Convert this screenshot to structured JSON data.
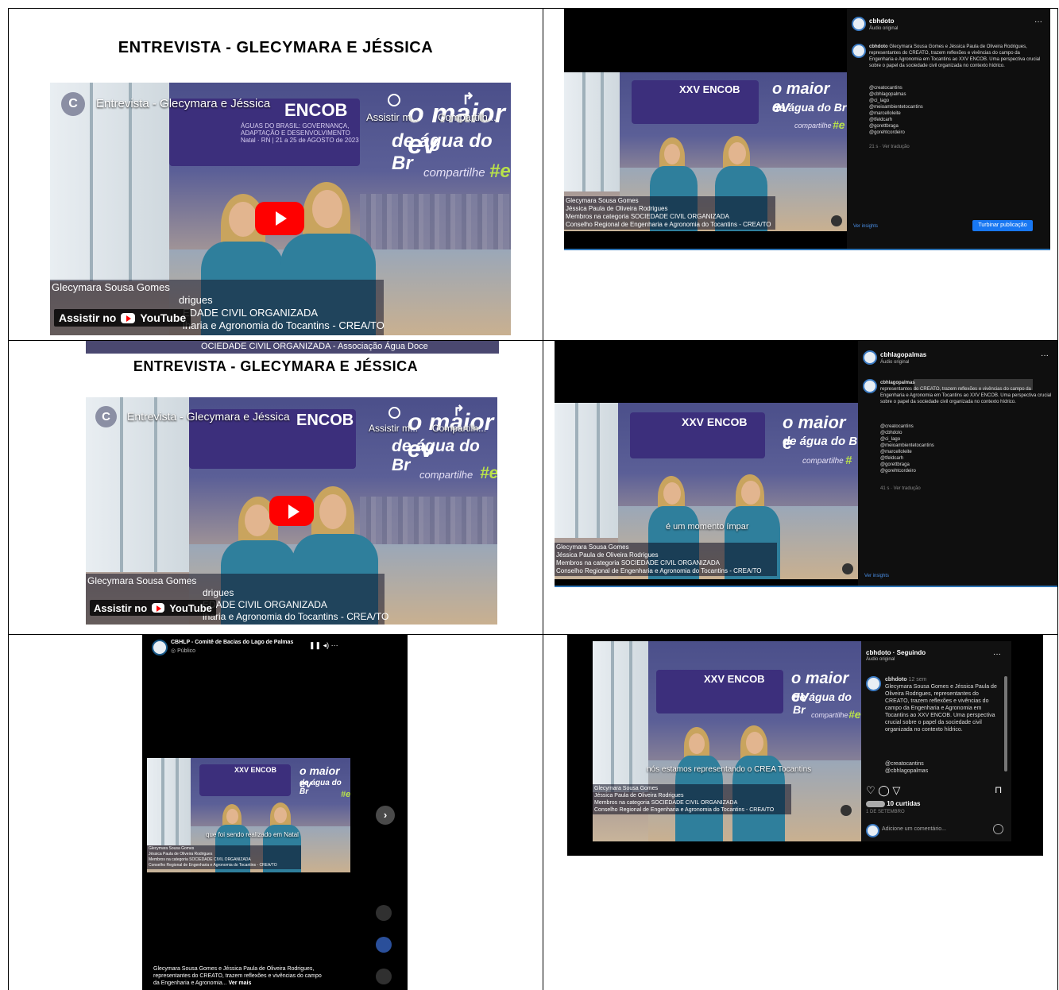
{
  "cell1": {
    "heading": "ENTREVISTA - GLECYMARA E JÉSSICA",
    "video_title": "Entrevista - Glecymara e Jéssica",
    "channel_initial": "C",
    "watch_later": "Assistir m...",
    "share": "Compartilh...",
    "encob": "ENCOB",
    "encob_sub1": "ÁGUAS DO BRASIL: GOVERNANÇA,",
    "encob_sub2": "ADAPTAÇÃO E DESENVOLVIMENTO",
    "encob_date": "Natal · RN  |  21 a 25 de AGOSTO de 2023",
    "slogan1": "o maior ev",
    "slogan2": "de água do Br",
    "compartilhe": "compartilhe",
    "hash": "#e",
    "lt1": "Glecymara Sousa Gomes",
    "lt2": "drigues",
    "lt3": "EDADE CIVIL ORGANIZADA",
    "lt4": "lharia e Agronomia do Tocantins - CREA/TO",
    "watch_on": "Assistir no",
    "youtube": "YouTube",
    "below_strip": "OCIEDADE CIVIL ORGANIZADA - Associação Água Doce"
  },
  "cell2": {
    "heading": "ENTREVISTA - GLECYMARA E JÉSSICA",
    "video_title": "Entrevista - Glecymara e Jéssica",
    "channel_initial": "C",
    "watch_later": "Assistir m...",
    "share": "Compartilh...",
    "encob": "ENCOB",
    "slogan1": "o maior ev",
    "slogan2": "de água do Br",
    "compartilhe": "compartilhe",
    "hash": "#e",
    "lt1": "Glecymara Sousa Gomes",
    "lt2": "drigues",
    "lt3": "EDADE CIVIL ORGANIZADA",
    "lt4": "lharia e Agronomia do Tocantins - CREA/TO",
    "watch_on": "Assistir no",
    "youtube": "YouTube"
  },
  "ig1": {
    "user": "cbhdoto",
    "audio": "Áudio original",
    "caption_user": "cbhdoto",
    "caption": "Glecymara Sousa Gomes e Jéssica Paula de Oliveira Rodrigues, representantes do CREATO, trazem reflexões e vivências do campo da Engenharia e Agronomia em Tocantins ao XXV ENCOB. Uma perspectiva crucial sobre o papel da sociedade civil organizada no contexto hídrico.",
    "tags": [
      "@creatocantins",
      "@cbhlagopalmas",
      "@ci_lago",
      "@meioambientetocantins",
      "@marcelloleite",
      "@tfeldcarh",
      "@gorettbraga",
      "@gorehtcordeiro"
    ],
    "time": "21 s · Ver tradução",
    "insights": "Ver insights",
    "boost": "Turbinar publicação",
    "xxv": "XXV ENCOB",
    "slogan1": "o maior ev",
    "slogan2": "de água do Br",
    "compartilhe": "compartilhe",
    "hash": "#e",
    "lt": [
      "Glecymara Sousa Gomes",
      "Jéssica Paula de Oliveira Rodrigues",
      "Membros na categoria SOCIEDADE CIVIL ORGANIZADA",
      "Conselho Regional de Engenharia e Agronomia do Tocantins - CREA/TO"
    ]
  },
  "ig2": {
    "user": "cbhlagopalmas",
    "audio": "Áudio original",
    "caption_user": "cbhlagopalmas",
    "caption": "representantes do CREATO, trazem reflexões e vivências do campo da Engenharia e Agronomia em Tocantins ao XXV ENCOB. Uma perspectiva crucial sobre o papel da sociedade civil organizada no contexto hídrico.",
    "tags": [
      "@creatocantins",
      "@cbhdoto",
      "@ci_lago",
      "@meioambientetocantins",
      "@marcelloleite",
      "@tfeldcarh",
      "@gorettbraga",
      "@gorehtcordeiro"
    ],
    "time": "41 s · Ver tradução",
    "insights": "Ver insights",
    "xxv": "XXV ENCOB",
    "slogan1": "o maior e",
    "slogan2": "de água do B",
    "compartilhe": "compartilhe",
    "hash": "#",
    "subtitle": "é um momento ímpar",
    "lt": [
      "Glecymara Sousa Gomes",
      "Jéssica Paula de Oliveira Rodrigues",
      "Membros na categoria SOCIEDADE CIVIL ORGANIZADA",
      "Conselho Regional de Engenharia e Agronomia do Tocantins - CREA/TO"
    ]
  },
  "fb": {
    "page": "CBHLP - Comitê de Bacias do Lago de Palmas",
    "visibility": "Público",
    "xxv": "XXV ENCOB",
    "slogan1": "o maior ev",
    "slogan2": "de água do Br",
    "hash": "#e",
    "subtitle": "que foi sendo realizado em Natal",
    "lt": [
      "Glecymara Sousa Gomes",
      "Jéssica Paula de Oliveira Rodrigues",
      "Membros na categoria SOCIEDADE CIVIL ORGANIZADA",
      "Conselho Regional de Engenharia e Agronomia do Tocantins - CREA/TO"
    ],
    "caption1": "Glecymara Sousa Gomes e Jéssica Paula de Oliveira Rodrigues,",
    "caption2": "representantes do CREATO, trazem reflexões e vivências do campo",
    "caption3": "da Engenharia e Agronomia...",
    "see_more": "Ver mais"
  },
  "post": {
    "user": "cbhdoto · Seguindo",
    "audio": "Áudio original",
    "caption_user": "cbhdoto",
    "caption_time": "12 sem",
    "caption": "Glecymara Sousa Gomes e Jéssica Paula de Oliveira Rodrigues, representantes do CREATO, trazem reflexões e vivências do campo da Engenharia e Agronomia em Tocantins ao XXV ENCOB. Uma perspectiva crucial sobre o papel da sociedade civil organizada no contexto hídrico.",
    "tags": [
      "@creatocantins",
      "@cbhlagopalmas"
    ],
    "likes": "10 curtidas",
    "date": "1 DE SETEMBRO",
    "comment_placeholder": "Adicione um comentário...",
    "xxv": "XXV ENCOB",
    "slogan1": "o maior ev",
    "slogan2": "de água do Br",
    "compartilhe": "compartilhe",
    "hash": "#e",
    "subtitle": "nós estamos representando o CREA Tocantins",
    "lt": [
      "Glecymara Sousa Gomes",
      "Jéssica Paula de Oliveira Rodrigues",
      "Membros na categoria SOCIEDADE CIVIL ORGANIZADA",
      "Conselho Regional de Engenharia e Agronomia do Tocantins - CREA/TO"
    ]
  }
}
